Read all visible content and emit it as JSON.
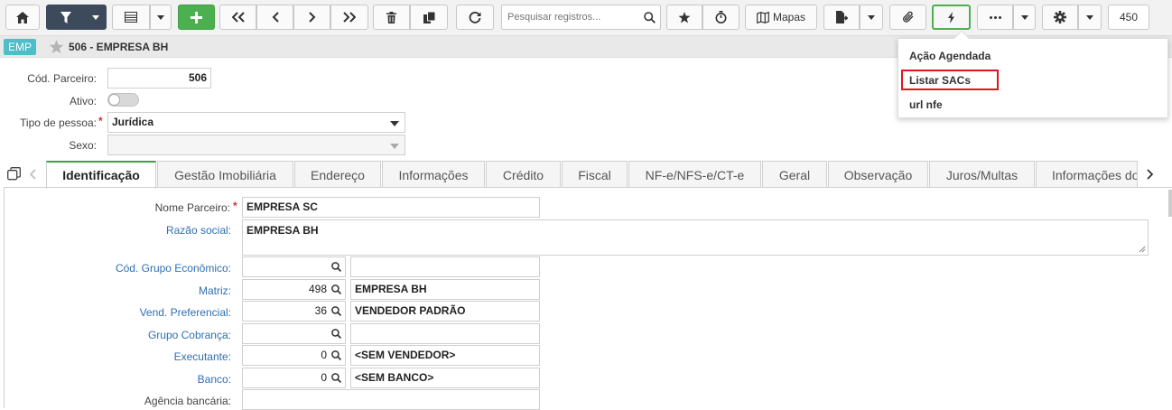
{
  "toolbar": {
    "search_placeholder": "Pesquisar registros...",
    "mapas_label": "Mapas",
    "record_count": "450"
  },
  "header": {
    "badge": "EMP",
    "title": "506 - EMPRESA BH"
  },
  "dropdown": {
    "items": [
      "Ação Agendada",
      "Listar SACs",
      "url nfe"
    ],
    "highlighted_index": 1
  },
  "form": {
    "cod_parceiro_label": "Cód. Parceiro:",
    "cod_parceiro_value": "506",
    "ativo_label": "Ativo:",
    "tipo_pessoa_label": "Tipo de pessoa:",
    "tipo_pessoa_value": "Jurídica",
    "sexo_label": "Sexo:"
  },
  "tabs": [
    "Identificação",
    "Gestão Imobiliária",
    "Endereço",
    "Informações",
    "Crédito",
    "Fiscal",
    "NF-e/NFS-e/CT-e",
    "Geral",
    "Observação",
    "Juros/Multas",
    "Informações do"
  ],
  "ident": {
    "nome_parceiro_label": "Nome Parceiro:",
    "nome_parceiro_value": "EMPRESA SC",
    "razao_social_label": "Razão social:",
    "razao_social_value": "EMPRESA BH",
    "grupo_economico_label": "Cód. Grupo Econômico:",
    "matriz_label": "Matriz:",
    "matriz_code": "498",
    "matriz_name": "EMPRESA BH",
    "vend_label": "Vend. Preferencial:",
    "vend_code": "36",
    "vend_name": "VENDEDOR PADRÃO",
    "grupo_cobranca_label": "Grupo Cobrança:",
    "executante_label": "Executante:",
    "executante_code": "0",
    "executante_name": "<SEM VENDEDOR>",
    "banco_label": "Banco:",
    "banco_code": "0",
    "banco_name": "<SEM BANCO>",
    "agencia_label": "Agência bancária:"
  }
}
